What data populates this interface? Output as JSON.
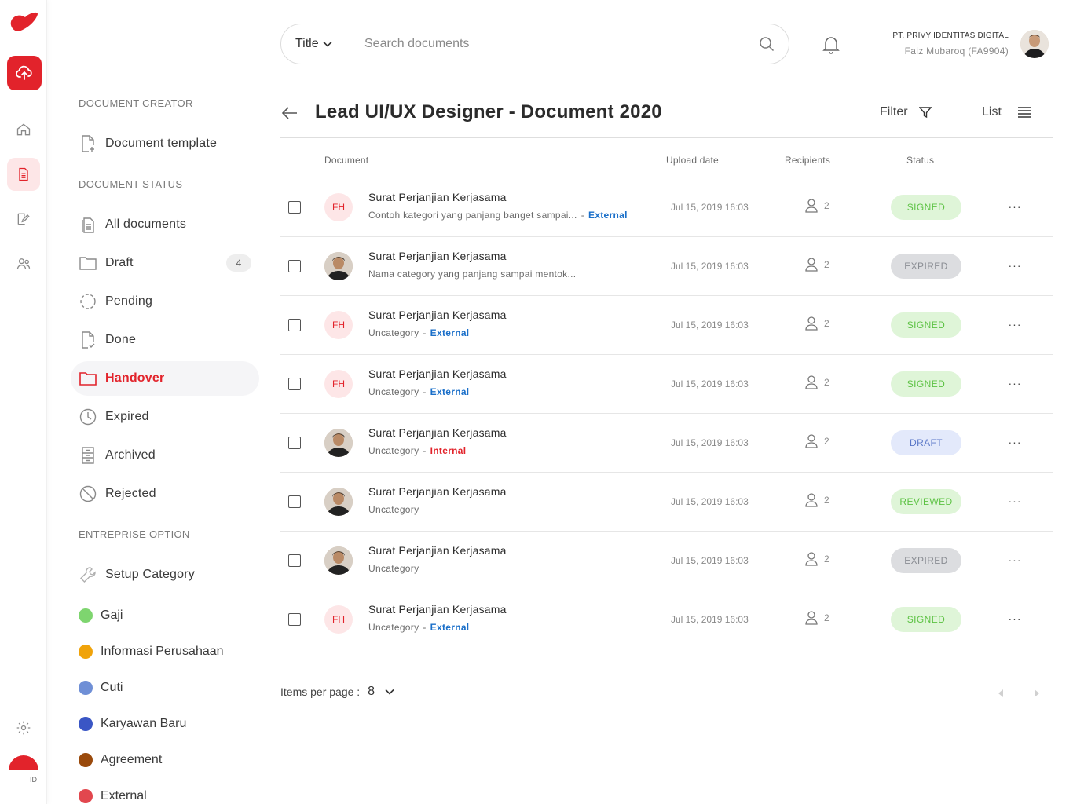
{
  "colors": {
    "brand": "#e2232b",
    "signed_bg": "#dff5d8",
    "signed_fg": "#5cc243",
    "expired_bg": "#dcdde0",
    "expired_fg": "#8a8d93",
    "draft_bg": "#e3e9fb",
    "draft_fg": "#5b78c8",
    "external": "#1a6fc9",
    "internal": "#e2232b"
  },
  "search": {
    "type_label": "Title",
    "placeholder": "Search documents"
  },
  "user": {
    "org": "PT. PRIVY IDENTITAS DIGITAL",
    "name": "Faiz Mubaroq (FA9904)"
  },
  "rail": {
    "lang": "ID"
  },
  "sidebar": {
    "section_creator": "DOCUMENT CREATOR",
    "template": "Document template",
    "section_status": "DOCUMENT STATUS",
    "items": [
      {
        "label": "All documents"
      },
      {
        "label": "Draft",
        "count": "4"
      },
      {
        "label": "Pending"
      },
      {
        "label": "Done"
      },
      {
        "label": "Handover"
      },
      {
        "label": "Expired"
      },
      {
        "label": "Archived"
      },
      {
        "label": "Rejected"
      }
    ],
    "section_enterprise": "ENTREPRISE OPTION",
    "setup": "Setup Category",
    "categories": [
      {
        "label": "Gaji",
        "color": "#7ed56f"
      },
      {
        "label": "Informasi Perusahaan",
        "color": "#f0a30a"
      },
      {
        "label": "Cuti",
        "color": "#6f8fd6"
      },
      {
        "label": "Karyawan Baru",
        "color": "#3a56c5"
      },
      {
        "label": "Agreement",
        "color": "#9a4a0c"
      },
      {
        "label": "External",
        "color": "#e2474e"
      }
    ]
  },
  "page": {
    "title": "Lead UI/UX Designer - Document 2020",
    "filter": "Filter",
    "list": "List"
  },
  "table": {
    "headers": {
      "document": "Document",
      "upload": "Upload date",
      "recipients": "Recipients",
      "status": "Status"
    },
    "rows": [
      {
        "avatar": "FH",
        "title": "Surat Perjanjian Kerjasama",
        "sub": "Contoh kategori yang panjang banget sampai...",
        "tag": "External",
        "date": "Jul 15, 2019 16:03",
        "recipients": "2",
        "status": "SIGNED"
      },
      {
        "avatar": "photo",
        "title": "Surat Perjanjian Kerjasama",
        "sub": "Nama category yang panjang sampai mentok...",
        "tag": "",
        "date": "Jul 15, 2019 16:03",
        "recipients": "2",
        "status": "EXPIRED"
      },
      {
        "avatar": "FH",
        "title": "Surat Perjanjian Kerjasama",
        "sub": "Uncategory",
        "tag": "External",
        "date": "Jul 15, 2019 16:03",
        "recipients": "2",
        "status": "SIGNED"
      },
      {
        "avatar": "FH",
        "title": "Surat Perjanjian Kerjasama",
        "sub": "Uncategory",
        "tag": "External",
        "date": "Jul 15, 2019 16:03",
        "recipients": "2",
        "status": "SIGNED"
      },
      {
        "avatar": "photo",
        "title": "Surat Perjanjian Kerjasama",
        "sub": "Uncategory",
        "tag": "Internal",
        "date": "Jul 15, 2019 16:03",
        "recipients": "2",
        "status": "DRAFT"
      },
      {
        "avatar": "photo",
        "title": "Surat Perjanjian Kerjasama",
        "sub": "Uncategory",
        "tag": "",
        "date": "Jul 15, 2019 16:03",
        "recipients": "2",
        "status": "REVIEWED"
      },
      {
        "avatar": "photo",
        "title": "Surat Perjanjian Kerjasama",
        "sub": "Uncategory",
        "tag": "",
        "date": "Jul 15, 2019 16:03",
        "recipients": "2",
        "status": "EXPIRED"
      },
      {
        "avatar": "FH",
        "title": "Surat Perjanjian Kerjasama",
        "sub": "Uncategory",
        "tag": "External",
        "date": "Jul 15, 2019 16:03",
        "recipients": "2",
        "status": "SIGNED"
      }
    ]
  },
  "footer": {
    "per_page_label": "Items per page :",
    "per_page_value": "8"
  }
}
